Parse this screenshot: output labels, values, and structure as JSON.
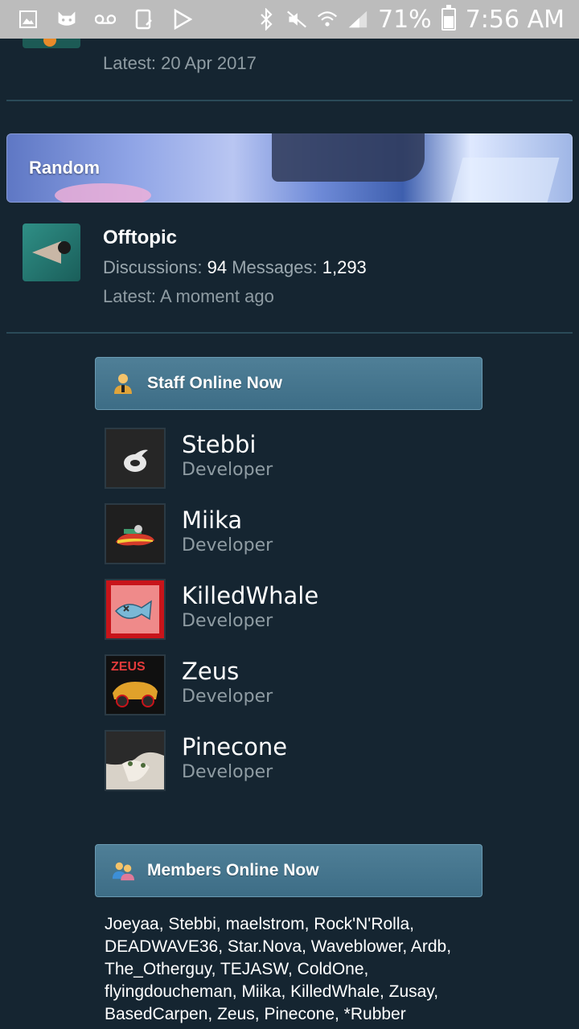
{
  "status_bar": {
    "battery": "71%",
    "time": "7:56 AM",
    "icons": [
      "image-icon",
      "cat-icon",
      "voicemail-icon",
      "tablet-icon",
      "play-icon",
      "bluetooth-icon",
      "mute-icon",
      "wifi-icon",
      "signal-icon",
      "battery-icon"
    ]
  },
  "previous_node": {
    "latest_label": "Latest:",
    "latest_value": "20 Apr 2017"
  },
  "category": {
    "title": "Random"
  },
  "node": {
    "title": "Offtopic",
    "discussions_label": "Discussions:",
    "discussions_value": "94",
    "messages_label": "Messages:",
    "messages_value": "1,293",
    "latest_label": "Latest:",
    "latest_value": "A moment ago"
  },
  "staff_online": {
    "title": "Staff Online Now",
    "members": [
      {
        "name": "Stebbi",
        "role": "Developer"
      },
      {
        "name": "Miika",
        "role": "Developer"
      },
      {
        "name": "KilledWhale",
        "role": "Developer"
      },
      {
        "name": "Zeus",
        "role": "Developer"
      },
      {
        "name": "Pinecone",
        "role": "Developer"
      }
    ]
  },
  "avatar_labels": {
    "zeus": "ZEUS"
  },
  "members_online": {
    "title": "Members Online Now",
    "list": "Joeyaa, Stebbi, maelstrom, Rock'N'Rolla, DEADWAVE36, Star.Nova, Waveblower, Ardb, The_Otherguy, TEJASW, ColdOne, flyingdoucheman, Miika, KilledWhale, Zusay, BasedCarpen, Zeus, Pinecone, *Rubber"
  },
  "colors": {
    "background": "#152531",
    "header_bar": "#4f7f97",
    "muted_text": "#8f9ca3",
    "status_bar": "#bcbcbc"
  }
}
